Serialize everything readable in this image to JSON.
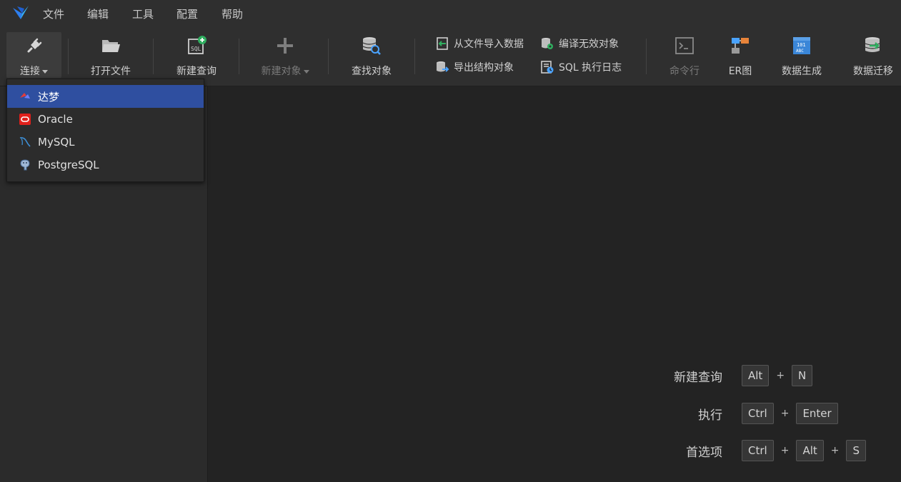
{
  "menubar": {
    "items": [
      "文件",
      "编辑",
      "工具",
      "配置",
      "帮助"
    ]
  },
  "toolbar": {
    "connect": "连接",
    "open_file": "打开文件",
    "new_query": "新建查询",
    "new_object": "新建对象",
    "find_object": "查找对象",
    "import_from_file": "从文件导入数据",
    "compile_invalid": "编译无效对象",
    "export_structure": "导出结构对象",
    "sql_log": "SQL 执行日志",
    "command_line": "命令行",
    "er_diagram": "ER图",
    "data_generate": "数据生成",
    "data_migrate": "数据迁移"
  },
  "connect_menu": {
    "items": [
      {
        "label": "达梦",
        "icon": "dameng-icon",
        "selected": true
      },
      {
        "label": "Oracle",
        "icon": "oracle-icon",
        "selected": false
      },
      {
        "label": "MySQL",
        "icon": "mysql-icon",
        "selected": false
      },
      {
        "label": "PostgreSQL",
        "icon": "postgresql-icon",
        "selected": false
      }
    ]
  },
  "shortcuts": [
    {
      "label": "新建查询",
      "keys": [
        "Alt",
        "N"
      ]
    },
    {
      "label": "执行",
      "keys": [
        "Ctrl",
        "Enter"
      ]
    },
    {
      "label": "首选项",
      "keys": [
        "Ctrl",
        "Alt",
        "S"
      ]
    }
  ],
  "colors": {
    "accent": "#2f4fa0",
    "background": "#262626",
    "toolbar": "#2f2f2f"
  }
}
